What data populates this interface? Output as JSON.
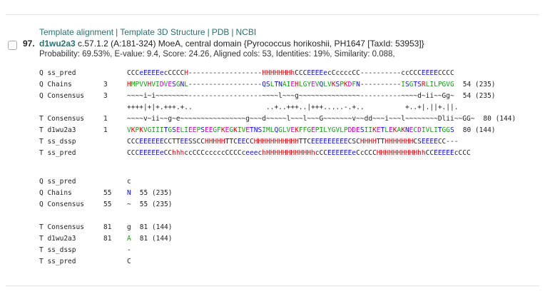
{
  "links": {
    "template_alignment": "Template alignment",
    "template_3d": "Template 3D Structure",
    "pdb": "PDB",
    "ncbi": "NCBI",
    "sep": "|"
  },
  "hit": {
    "number": "97.",
    "id": "d1wu2a3",
    "description": "c.57.1.2 (A:181-324) MoeA, central domain {Pyrococcus horikoshii, PH1647 [TaxId: 53953]}",
    "stats": "Probability: 69.53%,   E-value: 9.4,   Score: 24.26,   Aligned cols: 53,   Identities: 19%,   Similarity: 0.088,"
  },
  "colors": {
    "red": "#e0000a",
    "blue": "#1010e0",
    "green": "#10a010",
    "magenta": "#cc00cc",
    "link": "#2a6f6f"
  },
  "block1": [
    {
      "label": "Q ss_pred",
      "start": "",
      "seq": "CCCeEEEEecCCCCH------------------HHHHHHHhCCCEEEEecCccccCC----------ccCCCEEEECCCC",
      "end": ""
    },
    {
      "label": "Q Chains",
      "start": "3",
      "seq": "HMPVVHVIDVESGNL------------------QSLTNAIEHLGYEVQLVKSPKDFN----------ISGTSRLILPGVG",
      "end": "54 (235)"
    },
    {
      "label": "Q Consensus",
      "start": "3",
      "seq": "~~~~i~i~~~~~~~~------------------~~~~l~~~g~~~~~~~~~~~~~~~----------~~~~d~ii~~Gg~",
      "end": "54 (235)"
    },
    {
      "label": "",
      "start": "",
      "seq": "++++|+|+.+++.+..                  ..+..+++..|+++.....-.+..          +..+|.||+.||.",
      "end": ""
    },
    {
      "label": "T Consensus",
      "start": "1",
      "seq": "~~~~v~ii~~g~e~~~~~~~~~~~~~~~~g~~~d~~~~~l~~~l~~~G~~~~~~~v~~dd~~~i~~~l~~~~~~~~Dlii~~GG~",
      "end": "80 (144)"
    },
    {
      "label": "T d1wu2a3",
      "start": "1",
      "seq": "VKPKVGIIITGSELIEEPSEEGFKEGKIVETNSIMLQGLVEKFFGEPILYGVLPDDESIIKETLEKAKNECDIVLITGGS",
      "end": "80 (144)"
    },
    {
      "label": "T ss_dssp",
      "start": "",
      "seq": "CCCEEEEEECCTTEESSCCHHHHHTTCEECCHHHHHHHHHHHTTCEEEEEEEEECSCHHHHTTHHHHHHHCSEEEECC---",
      "end": ""
    },
    {
      "label": "T ss_pred",
      "start": "",
      "seq": "CCCEEEEEeCChhhccCCCcccccCCCCceeechHHHHHHHHHHHhcCCEEEEEEeCcCCCHHHHHHHHHHhhCCEEEEEcCCC",
      "end": ""
    }
  ],
  "block2": [
    {
      "label": "Q ss_pred",
      "start": "",
      "seq": "c",
      "end": ""
    },
    {
      "label": "Q Chains",
      "start": "55",
      "seq": "N",
      "end": "55 (235)"
    },
    {
      "label": "Q Consensus",
      "start": "55",
      "seq": "~",
      "end": "55 (235)"
    },
    {
      "label": "",
      "start": "",
      "seq": "",
      "end": ""
    },
    {
      "label": "T Consensus",
      "start": "81",
      "seq": "g",
      "end": "81 (144)"
    },
    {
      "label": "T d1wu2a3",
      "start": "81",
      "seq": "A",
      "end": "81 (144)"
    },
    {
      "label": "T ss_dssp",
      "start": "",
      "seq": "-",
      "end": ""
    },
    {
      "label": "T ss_pred",
      "start": "",
      "seq": "C",
      "end": ""
    }
  ]
}
